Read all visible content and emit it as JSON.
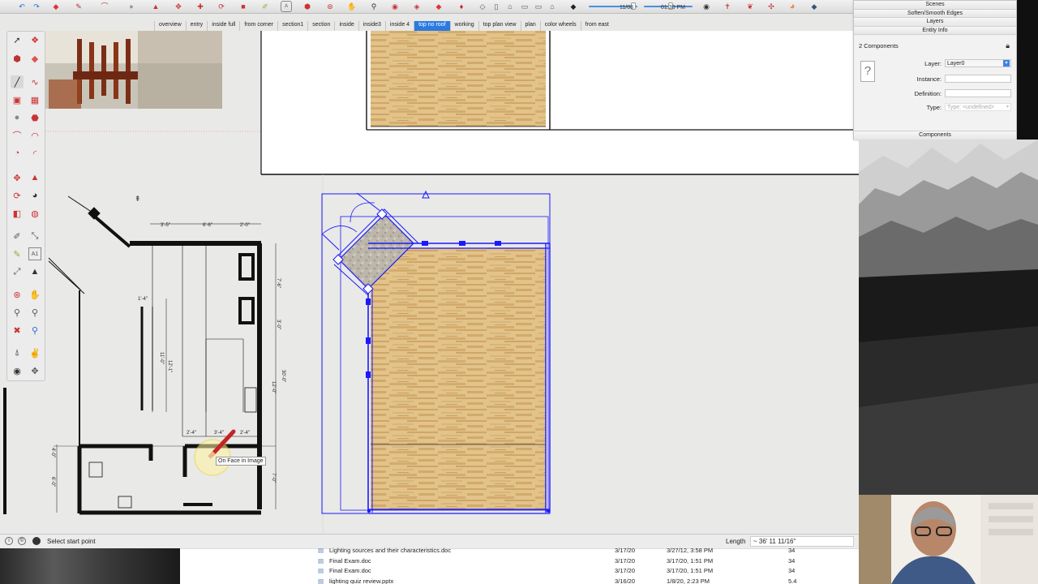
{
  "toolbar": {
    "time_start": "11/08",
    "time_end": "01:30 PM"
  },
  "scenes": [
    {
      "label": "overview",
      "active": false
    },
    {
      "label": "entry",
      "active": false
    },
    {
      "label": "inside full",
      "active": false
    },
    {
      "label": "from corner",
      "active": false
    },
    {
      "label": "section1",
      "active": false
    },
    {
      "label": "section",
      "active": false
    },
    {
      "label": "inside",
      "active": false
    },
    {
      "label": "inside3",
      "active": false
    },
    {
      "label": "inside 4",
      "active": false
    },
    {
      "label": "top no roof",
      "active": true
    },
    {
      "label": "working",
      "active": false
    },
    {
      "label": "top plan view",
      "active": false
    },
    {
      "label": "plan",
      "active": false
    },
    {
      "label": "color wheels",
      "active": false
    },
    {
      "label": "from east",
      "active": false
    }
  ],
  "tray": {
    "headers": [
      "Scenes",
      "Soften/Smooth Edges",
      "Layers",
      "Entity Info"
    ],
    "selection": "2 Components",
    "layer_label": "Layer:",
    "layer_value": "Layer0",
    "instance_label": "Instance:",
    "instance_value": "",
    "definition_label": "Definition:",
    "definition_value": "",
    "type_label": "Type:",
    "type_value": "Type: <undefined>",
    "footer": "Components"
  },
  "canvas": {
    "tooltip": "On Face in Image",
    "dims_top": [
      "3'-5\"",
      "6'-6\"",
      "2'-0\""
    ],
    "dims_right": [
      "7'-6\"",
      "3'-0\"",
      "30'-0\"",
      "12'-0\"",
      "7'-0\""
    ],
    "dims_left": [
      "4'-0\"",
      "6'-0\""
    ],
    "dims_inner": [
      "1'-4\"",
      "11'-0\"",
      "12'-1\"",
      "2'-4\"",
      "3'-4\"",
      "2'-4\""
    ]
  },
  "status": {
    "text": "Select start point",
    "vcb_label": "Length",
    "vcb_value": "~ 36' 11 11/16\""
  },
  "finder": [
    {
      "name": "Lighting sources and their characteristics.doc",
      "date1": "3/17/20",
      "date2": "3/27/12, 3:58 PM",
      "size": "34"
    },
    {
      "name": "Final Exam.doc",
      "date1": "3/17/20",
      "date2": "3/17/20, 1:51 PM",
      "size": "34"
    },
    {
      "name": "Final Exam.doc",
      "date1": "3/17/20",
      "date2": "3/17/20, 1:51 PM",
      "size": "34"
    },
    {
      "name": "lighting quiz review.pptx",
      "date1": "3/16/20",
      "date2": "1/8/20, 2:23 PM",
      "size": "5.4"
    }
  ],
  "colors": {
    "selection": "#1a1aff",
    "wood_light": "#e2c38a",
    "wood_dark": "#c89a5a",
    "active_tab": "#2a7ae2"
  }
}
